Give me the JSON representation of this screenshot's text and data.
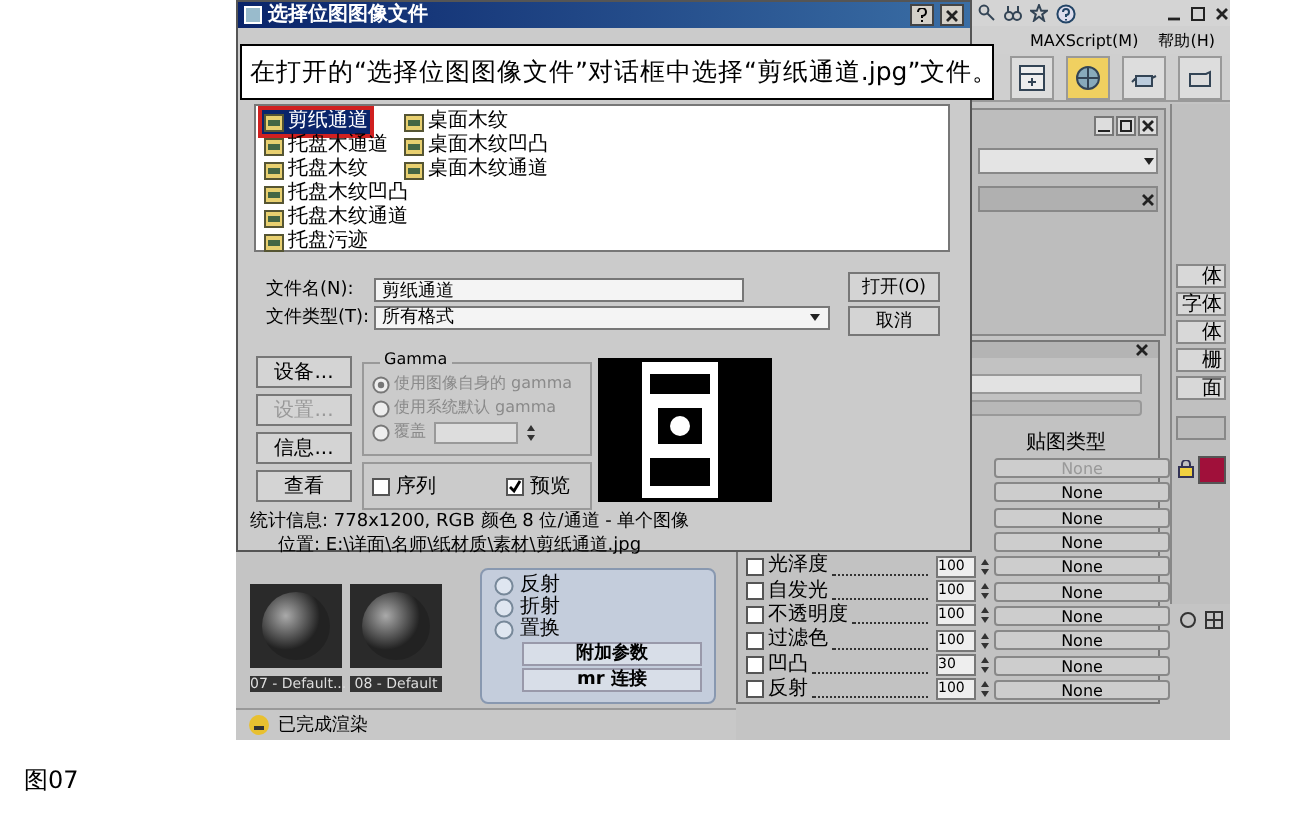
{
  "app": {
    "menu": [
      "MAXScript(M)",
      "帮助(H)"
    ],
    "command_buttons": [
      "体",
      "字体",
      "体",
      "栅",
      "面"
    ],
    "samples": [
      {
        "name": "07 - Default..."
      },
      {
        "name": "08 - Default"
      }
    ],
    "rollout": {
      "options": [
        "反射",
        "折射",
        "置换"
      ],
      "buttons": [
        "附加参数",
        "mr 连接"
      ]
    },
    "status": "已完成渲染"
  },
  "material_editor": {
    "column_header": "贴图类型",
    "rows": [
      {
        "map": "None",
        "disabled": true
      },
      {
        "map": "None",
        "disabled": false
      },
      {
        "map": "None",
        "disabled": false
      },
      {
        "map": "None",
        "disabled": false
      },
      {
        "label": "光泽度",
        "checked": false,
        "amount": "100",
        "map": "None",
        "disabled": false
      },
      {
        "label": "自发光",
        "checked": false,
        "amount": "100",
        "map": "None",
        "disabled": false
      },
      {
        "label": "不透明度",
        "checked": false,
        "amount": "100",
        "map": "None",
        "disabled": false
      },
      {
        "label": "过滤色",
        "checked": false,
        "amount": "100",
        "map": "None",
        "disabled": false
      },
      {
        "label": "凹凸",
        "checked": false,
        "amount": "30",
        "map": "None",
        "disabled": false
      },
      {
        "label": "反射",
        "checked": false,
        "amount": "100",
        "map": "None",
        "disabled": false
      }
    ]
  },
  "dialog": {
    "title": "选择位图图像文件",
    "files": [
      {
        "name": "剪纸通道",
        "selected": true
      },
      {
        "name": "托盘木通道",
        "selected": false
      },
      {
        "name": "托盘木纹",
        "selected": false
      },
      {
        "name": "托盘木纹凹凸",
        "selected": false
      },
      {
        "name": "托盘木纹通道",
        "selected": false
      },
      {
        "name": "托盘污迹",
        "selected": false
      },
      {
        "name": "桌面木纹",
        "selected": false
      },
      {
        "name": "桌面木纹凹凸",
        "selected": false
      },
      {
        "name": "桌面木纹通道",
        "selected": false
      }
    ],
    "file_name_label": "文件名(N):",
    "file_name": "剪纸通道",
    "file_type_label": "文件类型(T):",
    "file_type": "所有格式",
    "open_button": "打开(O)",
    "cancel_button": "取消",
    "side_buttons": [
      {
        "label": "设备...",
        "disabled": false
      },
      {
        "label": "设置...",
        "disabled": true
      },
      {
        "label": "信息...",
        "disabled": false
      },
      {
        "label": "查看",
        "disabled": false
      }
    ],
    "gamma": {
      "title": "Gamma",
      "disabled": true,
      "options": [
        {
          "label": "使用图像自身的 gamma",
          "selected": true
        },
        {
          "label": "使用系统默认 gamma",
          "selected": false
        },
        {
          "label": "覆盖",
          "selected": false
        }
      ]
    },
    "sequence": {
      "label": "序列",
      "checked": false
    },
    "preview": {
      "label": "预览",
      "checked": true
    },
    "stats": "统计信息: 778x1200, RGB 颜色 8 位/通道 - 单个图像",
    "location": "位置: E:\\详面\\名师\\纸材质\\素材\\剪纸通道.jpg"
  },
  "callout": "在打开的“选择位图图像文件”对话框中选择“剪纸通道.jpg”文件。",
  "caption": "图07"
}
